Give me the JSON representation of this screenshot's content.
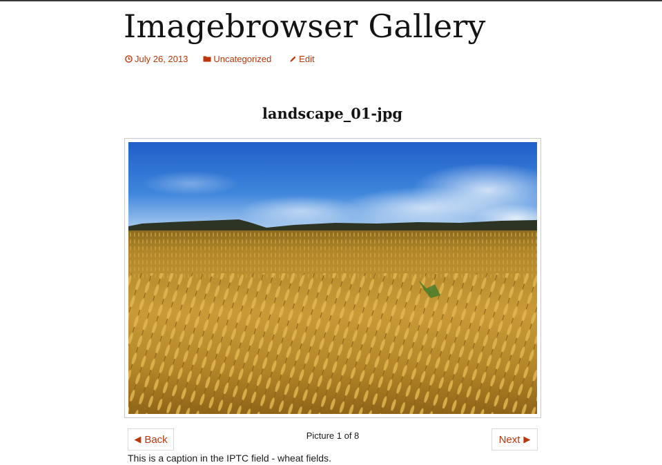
{
  "post": {
    "title": "Imagebrowser Gallery",
    "meta": {
      "date": "July 26, 2013",
      "date_icon": "clock-icon",
      "category": "Uncategorized",
      "category_icon": "folder-icon",
      "edit": "Edit",
      "edit_icon": "pencil-icon",
      "link_color": "#bc360a"
    }
  },
  "imagebrowser": {
    "image_title": "landscape_01-jpg",
    "image_alt": "wheat field under blue sky",
    "back": {
      "arrow": "◀",
      "label": "Back"
    },
    "next": {
      "label": "Next",
      "arrow": "▶"
    },
    "counter": "Picture 1 of 8",
    "caption": "This is a caption in the IPTC field - wheat fields."
  }
}
